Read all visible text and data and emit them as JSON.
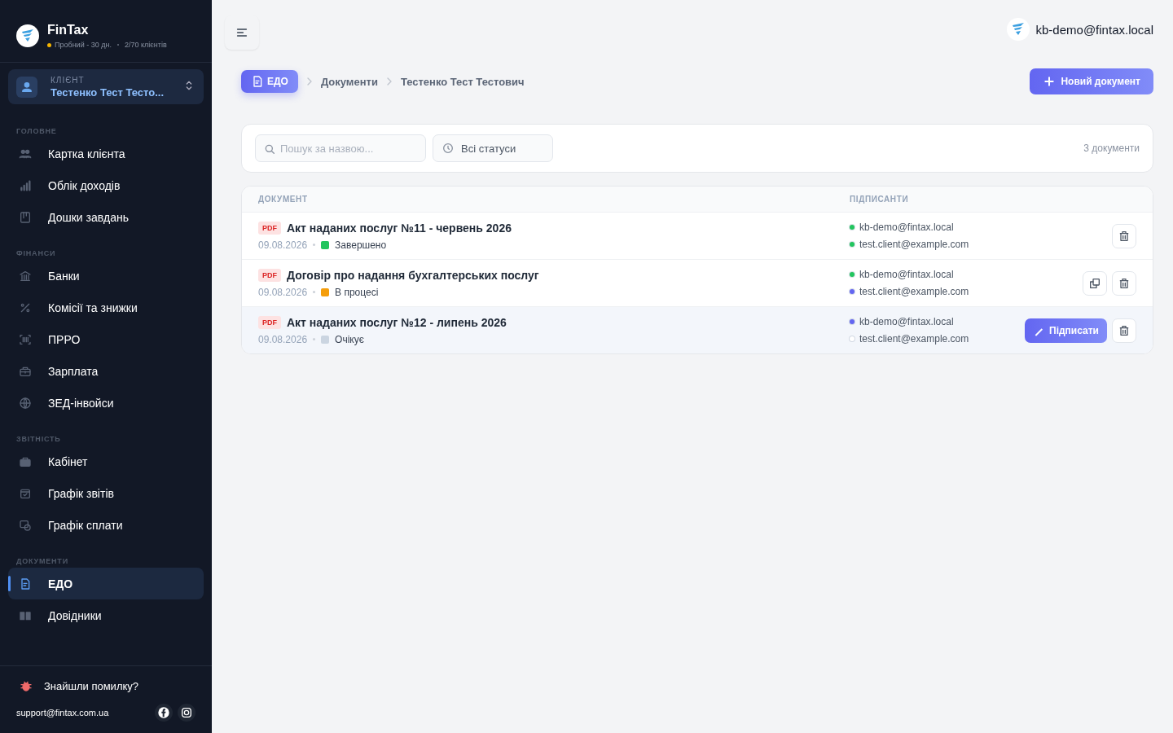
{
  "brand": {
    "name": "FinTax",
    "plan": "Пробний - 30 дн.",
    "clients": "2/70 клієнтів"
  },
  "client_picker": {
    "label": "КЛІЄНТ",
    "value": "Тестенко Тест Тесто..."
  },
  "nav_sections": [
    {
      "title": "ГОЛОВНЕ",
      "items": [
        {
          "label": "Картка клієнта",
          "selected": false
        },
        {
          "label": "Облік доходів",
          "selected": false
        },
        {
          "label": "Дошки завдань",
          "selected": false
        }
      ]
    },
    {
      "title": "ФІНАНСИ",
      "items": [
        {
          "label": "Банки",
          "selected": false
        },
        {
          "label": "Комісії та знижки",
          "selected": false
        },
        {
          "label": "ПРРО",
          "selected": false
        },
        {
          "label": "Зарплата",
          "selected": false
        },
        {
          "label": "ЗЕД-інвойси",
          "selected": false
        }
      ]
    },
    {
      "title": "ЗВІТНІСТЬ",
      "items": [
        {
          "label": "Кабінет",
          "selected": false
        },
        {
          "label": "Графік звітів",
          "selected": false
        },
        {
          "label": "Графік сплати",
          "selected": false
        }
      ]
    },
    {
      "title": "ДОКУМЕНТИ",
      "items": [
        {
          "label": "ЕДО",
          "selected": true
        },
        {
          "label": "Довідники",
          "selected": false
        }
      ]
    }
  ],
  "sidebar_footer": {
    "bug_report": "Знайшли помилку?",
    "email": "support@fintax.com.ua"
  },
  "user": {
    "email": "kb-demo@fintax.local"
  },
  "breadcrumb": [
    "ЕДО",
    "Документи",
    "Тестенко Тест Тестович"
  ],
  "new_button": "Новий документ",
  "filters": {
    "search_placeholder": "Пошук за назвою...",
    "status": "Всі статуси",
    "count": "3 документи"
  },
  "table": {
    "columns": [
      "ДОКУМЕНТ",
      "ПІДПИСАНТИ"
    ],
    "rows": [
      {
        "type": "PDF",
        "title": "Акт наданих послуг №11 - червень 2026",
        "date": "09.08.2026",
        "status": "Завершено",
        "color": "#22c55e",
        "selected": false,
        "signers": [
          {
            "email": "kb-demo@fintax.local",
            "color": "#22c55e"
          },
          {
            "email": "test.client@example.com",
            "color": "#22c55e"
          }
        ],
        "actions": [
          {
            "kind": "delete"
          }
        ]
      },
      {
        "type": "PDF",
        "title": "Договір про надання бухгалтерських послуг",
        "date": "09.08.2026",
        "status": "В процесі",
        "color": "#f59e0b",
        "selected": false,
        "signers": [
          {
            "email": "kb-demo@fintax.local",
            "color": "#22c55e"
          },
          {
            "email": "test.client@example.com",
            "color": "#6366f1"
          }
        ],
        "actions": [
          {
            "kind": "copy"
          },
          {
            "kind": "delete"
          }
        ]
      },
      {
        "type": "PDF",
        "title": "Акт наданих послуг №12 - липень 2026",
        "date": "09.08.2026",
        "status": "Очікує",
        "color": "#cbd5e1",
        "selected": true,
        "signers": [
          {
            "email": "kb-demo@fintax.local",
            "color": "#6366f1"
          },
          {
            "email": "test.client@example.com",
            "color": "#ffffff"
          }
        ],
        "actions": [
          {
            "kind": "sign",
            "label": "Підписати"
          },
          {
            "kind": "delete"
          }
        ]
      }
    ]
  }
}
